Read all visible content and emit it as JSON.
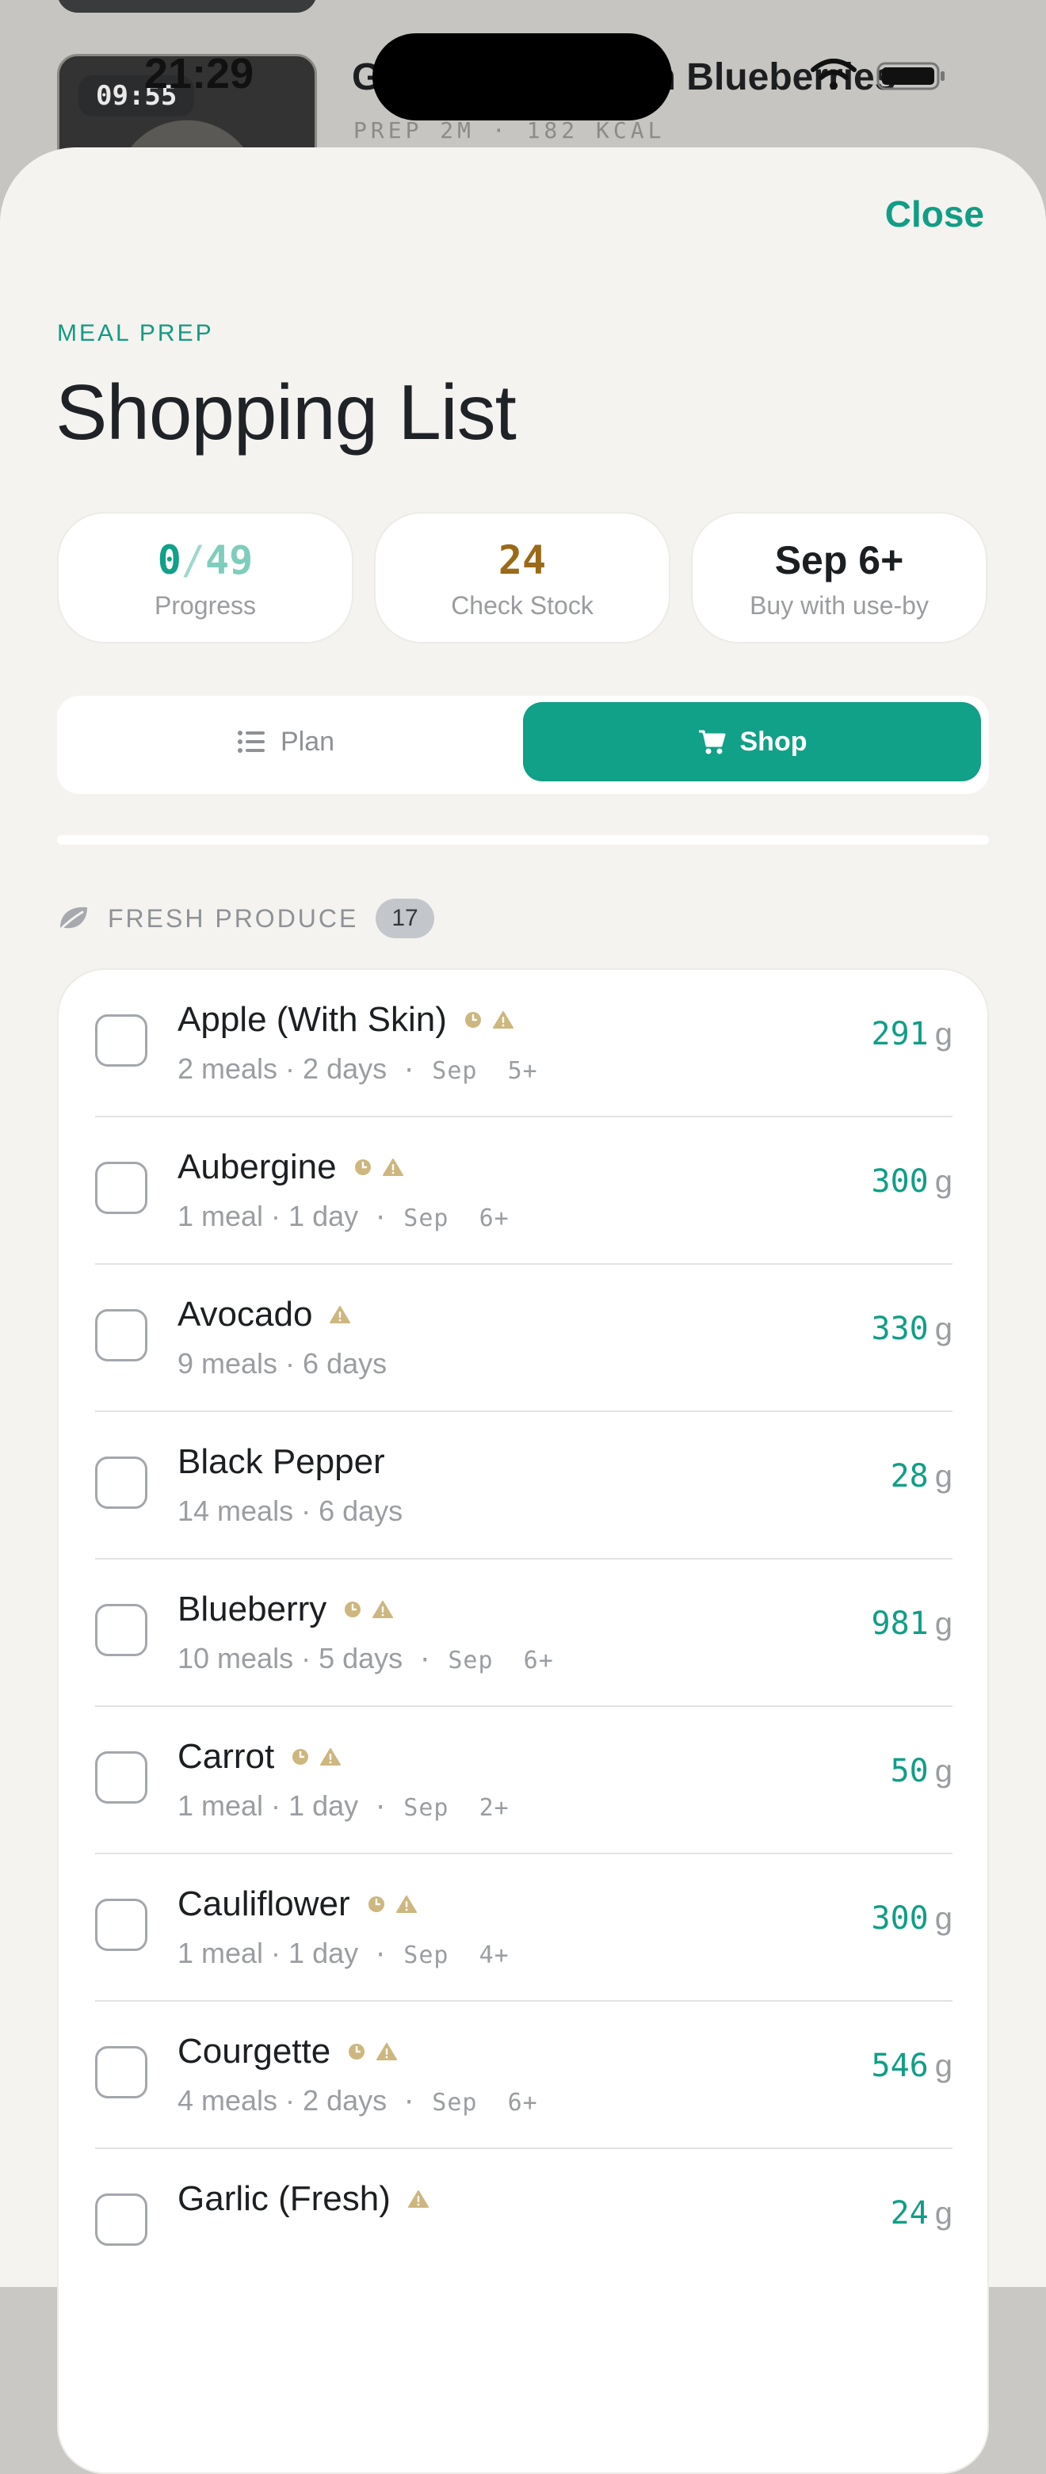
{
  "status_bar": {
    "time": "21:29"
  },
  "background": {
    "thumb_time": "09:55",
    "recipe_title": "Greek Yogurt with Blueberries",
    "recipe_meta": "PREP 2M · 182 KCAL"
  },
  "header": {
    "close_label": "Close",
    "eyebrow": "MEAL PREP",
    "title": "Shopping List"
  },
  "stats": {
    "progress_done": "0",
    "progress_sep": "/",
    "progress_total": "49",
    "progress_label": "Progress",
    "stock_value": "24",
    "stock_label": "Check Stock",
    "buy_value": "Sep 6+",
    "buy_label": "Buy with use-by"
  },
  "tabs": {
    "plan_label": "Plan",
    "shop_label": "Shop",
    "selected": "Shop"
  },
  "section": {
    "icon": "leaf-icon",
    "title": "FRESH PRODUCE",
    "count": "17"
  },
  "colors": {
    "accent": "#11a088",
    "stock_amber": "#9b6a18",
    "flag_tan": "#cdb77f"
  },
  "items": [
    {
      "name": "Apple (With Skin)",
      "meta": "2 meals · 2 days",
      "date": " · Sep  5+",
      "qty": "291",
      "unit": "g"
    },
    {
      "name": "Aubergine",
      "meta": "1 meal · 1 day",
      "date": " · Sep  6+",
      "qty": "300",
      "unit": "g"
    },
    {
      "name": "Avocado",
      "meta": "9 meals · 6 days",
      "date": "",
      "qty": "330",
      "unit": "g"
    },
    {
      "name": "Black Pepper",
      "meta": "14 meals · 6 days",
      "date": "",
      "qty": "28",
      "unit": "g"
    },
    {
      "name": "Blueberry",
      "meta": "10 meals · 5 days",
      "date": " · Sep  6+",
      "qty": "981",
      "unit": "g"
    },
    {
      "name": "Carrot",
      "meta": "1 meal · 1 day",
      "date": " · Sep  2+",
      "qty": "50",
      "unit": "g"
    },
    {
      "name": "Cauliflower",
      "meta": "1 meal · 1 day",
      "date": " · Sep  4+",
      "qty": "300",
      "unit": "g"
    },
    {
      "name": "Courgette",
      "meta": "4 meals · 2 days",
      "date": " · Sep  6+",
      "qty": "546",
      "unit": "g"
    },
    {
      "name": "Garlic (Fresh)",
      "meta": "",
      "date": "",
      "qty": "24",
      "unit": "g"
    }
  ]
}
